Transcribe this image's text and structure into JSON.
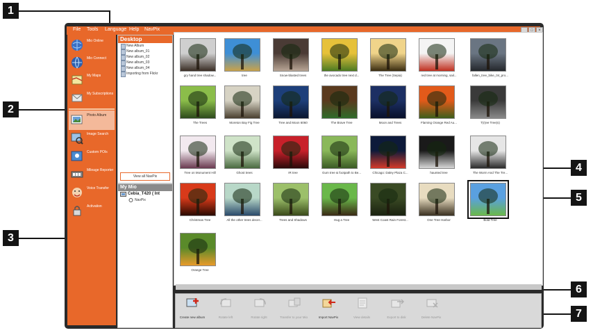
{
  "callouts": [
    "1",
    "2",
    "3",
    "4",
    "5",
    "6",
    "7"
  ],
  "menu": {
    "items": [
      "File",
      "Tools",
      "Language",
      "Help",
      "NavPix"
    ],
    "minimize": "_",
    "maximize": "□",
    "close": "×"
  },
  "sidebar": {
    "items": [
      {
        "label": "Mio Online",
        "icon": "globe-icon",
        "active": false
      },
      {
        "label": "Mio Connect",
        "icon": "globe-connect-icon",
        "active": false
      },
      {
        "label": "My Maps",
        "icon": "map-icon",
        "active": false
      },
      {
        "label": "My Subscriptions",
        "icon": "subscriptions-icon",
        "active": false
      },
      {
        "label": "Photo Album",
        "icon": "photo-album-icon",
        "active": true
      },
      {
        "label": "Image Search",
        "icon": "image-search-icon",
        "active": false
      },
      {
        "label": "Custom POIs",
        "icon": "poi-icon",
        "active": false
      },
      {
        "label": "Mileage Reporter",
        "icon": "mileage-icon",
        "active": false
      },
      {
        "label": "Voice Transfer",
        "icon": "voice-icon",
        "active": false
      },
      {
        "label": "Activation",
        "icon": "activation-icon",
        "active": false
      }
    ]
  },
  "folders": {
    "header": "Desktop",
    "items": [
      "New Album",
      "New album_01",
      "New album_02",
      "New album_03",
      "New album_04",
      "Importing from Flickr"
    ],
    "view_all": "View all NavPix"
  },
  "my_mio": {
    "header": "My Mio",
    "device": "Cebia_T420 ( Int",
    "navpix": "NavPix"
  },
  "photos": [
    {
      "caption": "gry hand tree shadow...",
      "colors": [
        "#cfcfcf",
        "#3a2e25"
      ]
    },
    {
      "caption": "tree",
      "colors": [
        "#3e8fd6",
        "#c9a24a"
      ]
    },
    {
      "caption": "Snow-blasted trees",
      "colors": [
        "#4a3b35",
        "#b8a595"
      ]
    },
    {
      "caption": "the avocado tree next d...",
      "colors": [
        "#e6c13a",
        "#4c7a22"
      ]
    },
    {
      "caption": "The Tree (Sepia)",
      "colors": [
        "#f0d48a",
        "#3a2c10"
      ]
    },
    {
      "caption": "red tree at morning, sail...",
      "colors": [
        "#f4f4f4",
        "#c03020"
      ]
    },
    {
      "caption": "fallen_tree_bike_04_pro...",
      "colors": [
        "#6a7582",
        "#24272c"
      ]
    },
    {
      "caption": "The Trees",
      "colors": [
        "#8bbd4a",
        "#2d4a1c"
      ]
    },
    {
      "caption": "Moreton Bay Fig Tree",
      "colors": [
        "#d7d3c4",
        "#4a4030"
      ]
    },
    {
      "caption": "Tree and Moon 6060",
      "colors": [
        "#1d3f7a",
        "#0b1730"
      ]
    },
    {
      "caption": "The Brave Tree",
      "colors": [
        "#5a3a1e",
        "#2f6b2a"
      ]
    },
    {
      "caption": "Moon and Trees",
      "colors": [
        "#1c2f63",
        "#08102a"
      ]
    },
    {
      "caption": "Flaming Orange Red Au...",
      "colors": [
        "#e25a1a",
        "#3d5e1b"
      ]
    },
    {
      "caption": "T(r)ee Tree(s)",
      "colors": [
        "#3a3a3a",
        "#8a8a8a"
      ]
    },
    {
      "caption": "Tree on Monument Hill",
      "colors": [
        "#f2e9ef",
        "#6a3a50"
      ]
    },
    {
      "caption": "Ghost trees",
      "colors": [
        "#cfe3c8",
        "#4a6a40"
      ]
    },
    {
      "caption": "IR tree",
      "colors": [
        "#c8202a",
        "#2a0a0a"
      ]
    },
    {
      "caption": "Gum tree & footpath to Be...",
      "colors": [
        "#8ab85a",
        "#3a5a24"
      ]
    },
    {
      "caption": "Chicago: Daley Plaza C...",
      "colors": [
        "#0d1a3a",
        "#d43a2a"
      ]
    },
    {
      "caption": "haunted tree",
      "colors": [
        "#1a1a1a",
        "#d8d8d8"
      ]
    },
    {
      "caption": "The Worm And The Tre...",
      "colors": [
        "#e6e6e6",
        "#2a2a2a"
      ]
    },
    {
      "caption": "Christmas Tree",
      "colors": [
        "#d83a1a",
        "#2a0a00"
      ]
    },
    {
      "caption": "All the other trees decer...",
      "colors": [
        "#b8d8c8",
        "#2a4a6a"
      ]
    },
    {
      "caption": "Trees and Shadows",
      "colors": [
        "#9cc06a",
        "#3a4a1a"
      ]
    },
    {
      "caption": "Hug a Tree",
      "colors": [
        "#6ab84a",
        "#3a2a14"
      ]
    },
    {
      "caption": "West Coast Rain Forest...",
      "colors": [
        "#3a4a24",
        "#1a2210"
      ]
    },
    {
      "caption": "One Tree Harbor",
      "colors": [
        "#e8dcc0",
        "#3a3020"
      ]
    },
    {
      "caption": "Bold Tree",
      "colors": [
        "#5aa0e0",
        "#6ab84a"
      ]
    },
    {
      "caption": "Orange Tree",
      "colors": [
        "#5a8a2a",
        "#e89a2a"
      ]
    }
  ],
  "toolbar": {
    "items": [
      {
        "label": "Create new album",
        "icon": "create-album-icon",
        "enabled": true
      },
      {
        "label": "Rotate left",
        "icon": "rotate-left-icon",
        "enabled": false
      },
      {
        "label": "Rotate right",
        "icon": "rotate-right-icon",
        "enabled": false
      },
      {
        "label": "Transfer to your Mio",
        "icon": "transfer-icon",
        "enabled": false
      },
      {
        "label": "Import NavPix",
        "icon": "import-navpix-icon",
        "enabled": true
      },
      {
        "label": "View details",
        "icon": "view-details-icon",
        "enabled": false
      },
      {
        "label": "Export to disk",
        "icon": "export-disk-icon",
        "enabled": false
      },
      {
        "label": "Delete NavPix",
        "icon": "delete-navpix-icon",
        "enabled": false
      }
    ]
  },
  "colors": {
    "accent": "#e8682a",
    "window_frame": "#2a2a2a",
    "toolbar_bg": "#d9d9d9"
  }
}
